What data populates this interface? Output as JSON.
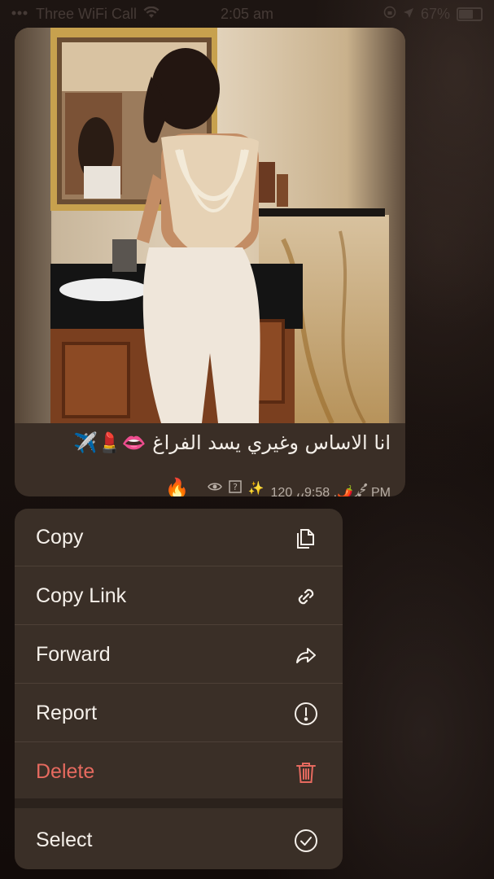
{
  "status_bar": {
    "carrier": "Three WiFi Call",
    "time": "2:05 am",
    "battery": "67%"
  },
  "message": {
    "caption": "انا الاساس وغيري يسد الفراغ 👄💄✈️",
    "emoji": "🔥",
    "meta_text": "120 ،،ﷴ🌶️, 9:58 PM",
    "meta_icons": [
      "eye-icon",
      "question-box-icon",
      "sparkles-icon"
    ]
  },
  "context_menu": {
    "items": [
      {
        "label": "Copy",
        "icon": "copy-icon"
      },
      {
        "label": "Copy Link",
        "icon": "link-icon"
      },
      {
        "label": "Forward",
        "icon": "forward-icon"
      },
      {
        "label": "Report",
        "icon": "report-icon"
      },
      {
        "label": "Delete",
        "icon": "trash-icon",
        "color": "#e66a5f"
      },
      {
        "label": "Select",
        "icon": "checkmark-circle-icon"
      }
    ]
  }
}
